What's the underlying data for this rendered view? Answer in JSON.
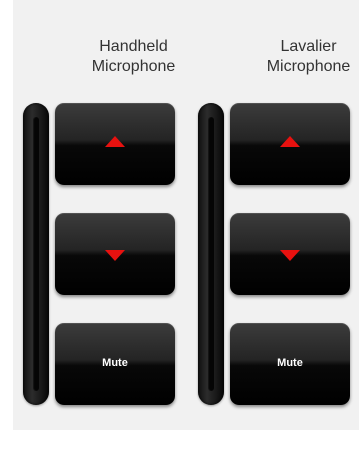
{
  "channels": [
    {
      "label_line1": "Handheld",
      "label_line2": "Microphone",
      "mute_label": "Mute"
    },
    {
      "label_line1": "Lavalier",
      "label_line2": "Microphone",
      "mute_label": "Mute"
    }
  ],
  "colors": {
    "arrow": "#e8110f",
    "panel_background": "#f1f1f1",
    "button": "#111111"
  },
  "icons": {
    "volume_up": "triangle-up-icon",
    "volume_down": "triangle-down-icon"
  }
}
